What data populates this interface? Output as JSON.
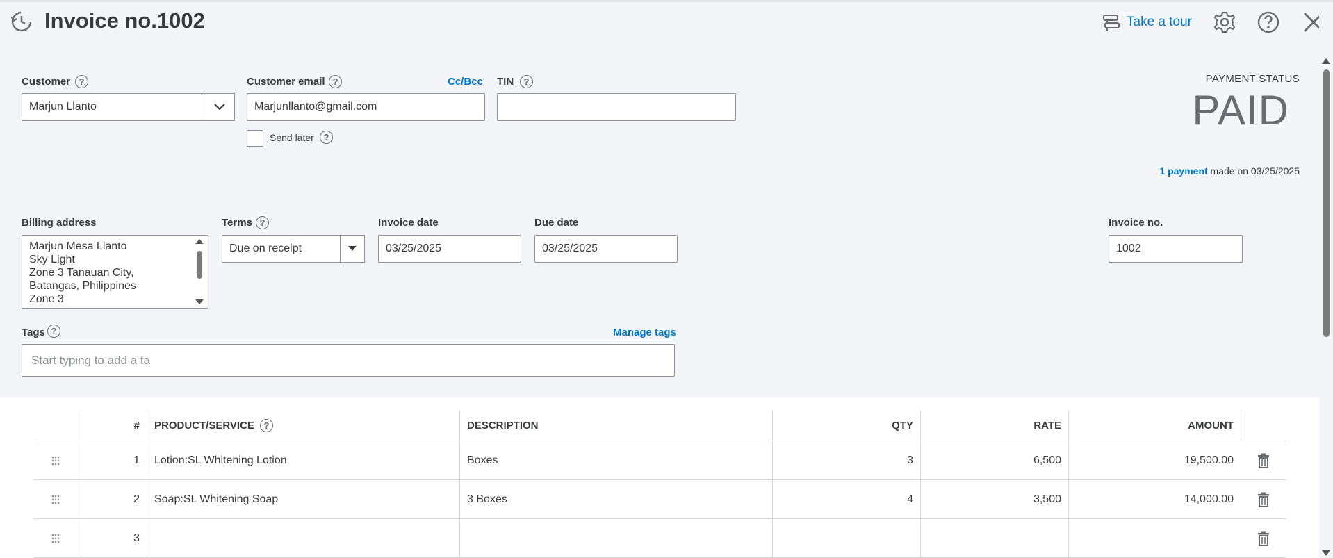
{
  "header": {
    "title": "Invoice no.1002",
    "tour_label": "Take a tour"
  },
  "customer": {
    "label": "Customer",
    "value": "Marjun Llanto"
  },
  "email": {
    "label": "Customer email",
    "value": "Marjunllanto@gmail.com",
    "cc_bcc": "Cc/Bcc",
    "send_later": "Send later"
  },
  "tin": {
    "label": "TIN",
    "value": ""
  },
  "payment": {
    "status_label": "PAYMENT STATUS",
    "status": "PAID",
    "link": "1 payment",
    "made_on": " made on 03/25/2025"
  },
  "billing": {
    "label": "Billing address",
    "lines": [
      "Marjun Mesa Llanto",
      "Sky Light",
      "Zone 3 Tanauan City,",
      "Batangas, Philippines",
      "Zone 3"
    ]
  },
  "terms": {
    "label": "Terms",
    "value": "Due on receipt"
  },
  "invoice_date": {
    "label": "Invoice date",
    "value": "03/25/2025"
  },
  "due_date": {
    "label": "Due date",
    "value": "03/25/2025"
  },
  "invoice_no": {
    "label": "Invoice no.",
    "value": "1002"
  },
  "tags": {
    "label": "Tags",
    "manage": "Manage tags",
    "placeholder": "Start typing to add a ta"
  },
  "table": {
    "headers": {
      "num": "#",
      "product": "PRODUCT/SERVICE",
      "description": "DESCRIPTION",
      "qty": "QTY",
      "rate": "RATE",
      "amount": "AMOUNT"
    },
    "rows": [
      {
        "num": "1",
        "product": "Lotion:SL Whitening Lotion",
        "description": "Boxes",
        "qty": "3",
        "rate": "6,500",
        "amount": "19,500.00"
      },
      {
        "num": "2",
        "product": "Soap:SL Whitening Soap",
        "description": "3 Boxes",
        "qty": "4",
        "rate": "3,500",
        "amount": "14,000.00"
      },
      {
        "num": "3",
        "product": "",
        "description": "",
        "qty": "",
        "rate": "",
        "amount": ""
      }
    ]
  }
}
